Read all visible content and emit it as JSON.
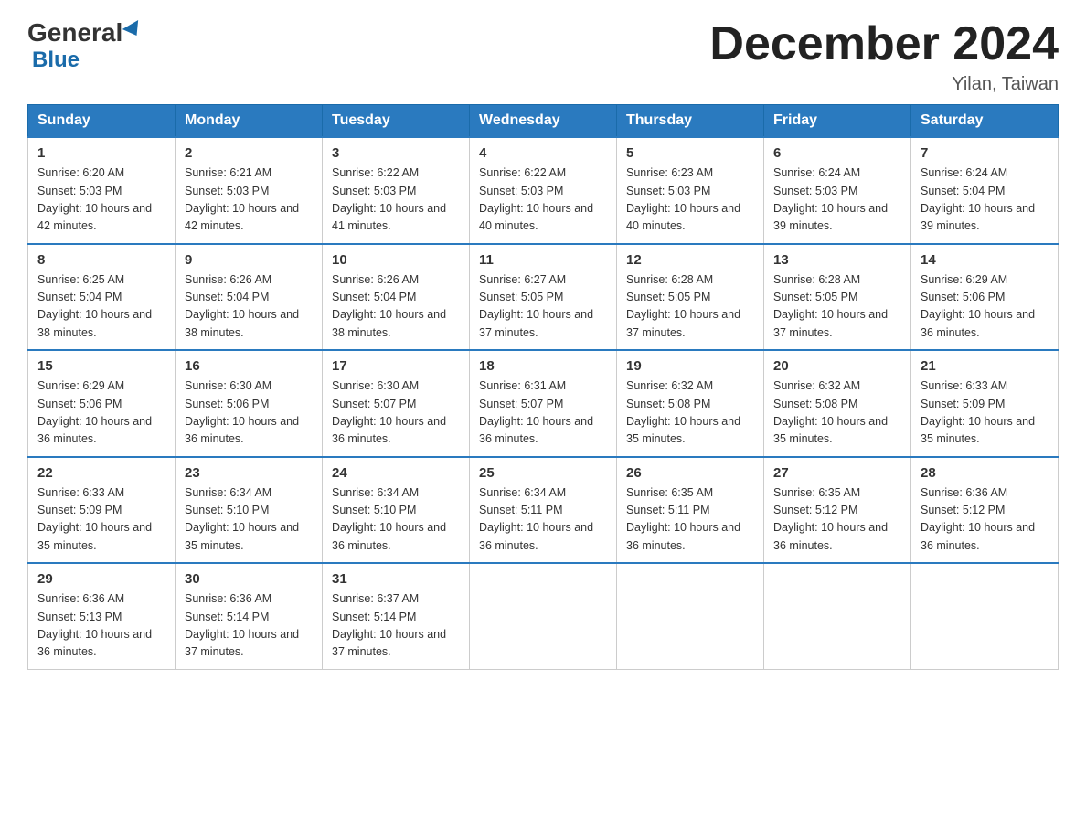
{
  "logo": {
    "general": "General",
    "blue": "Blue"
  },
  "title": "December 2024",
  "location": "Yilan, Taiwan",
  "days_of_week": [
    "Sunday",
    "Monday",
    "Tuesday",
    "Wednesday",
    "Thursday",
    "Friday",
    "Saturday"
  ],
  "weeks": [
    [
      {
        "day": "1",
        "sunrise": "6:20 AM",
        "sunset": "5:03 PM",
        "daylight": "10 hours and 42 minutes."
      },
      {
        "day": "2",
        "sunrise": "6:21 AM",
        "sunset": "5:03 PM",
        "daylight": "10 hours and 42 minutes."
      },
      {
        "day": "3",
        "sunrise": "6:22 AM",
        "sunset": "5:03 PM",
        "daylight": "10 hours and 41 minutes."
      },
      {
        "day": "4",
        "sunrise": "6:22 AM",
        "sunset": "5:03 PM",
        "daylight": "10 hours and 40 minutes."
      },
      {
        "day": "5",
        "sunrise": "6:23 AM",
        "sunset": "5:03 PM",
        "daylight": "10 hours and 40 minutes."
      },
      {
        "day": "6",
        "sunrise": "6:24 AM",
        "sunset": "5:03 PM",
        "daylight": "10 hours and 39 minutes."
      },
      {
        "day": "7",
        "sunrise": "6:24 AM",
        "sunset": "5:04 PM",
        "daylight": "10 hours and 39 minutes."
      }
    ],
    [
      {
        "day": "8",
        "sunrise": "6:25 AM",
        "sunset": "5:04 PM",
        "daylight": "10 hours and 38 minutes."
      },
      {
        "day": "9",
        "sunrise": "6:26 AM",
        "sunset": "5:04 PM",
        "daylight": "10 hours and 38 minutes."
      },
      {
        "day": "10",
        "sunrise": "6:26 AM",
        "sunset": "5:04 PM",
        "daylight": "10 hours and 38 minutes."
      },
      {
        "day": "11",
        "sunrise": "6:27 AM",
        "sunset": "5:05 PM",
        "daylight": "10 hours and 37 minutes."
      },
      {
        "day": "12",
        "sunrise": "6:28 AM",
        "sunset": "5:05 PM",
        "daylight": "10 hours and 37 minutes."
      },
      {
        "day": "13",
        "sunrise": "6:28 AM",
        "sunset": "5:05 PM",
        "daylight": "10 hours and 37 minutes."
      },
      {
        "day": "14",
        "sunrise": "6:29 AM",
        "sunset": "5:06 PM",
        "daylight": "10 hours and 36 minutes."
      }
    ],
    [
      {
        "day": "15",
        "sunrise": "6:29 AM",
        "sunset": "5:06 PM",
        "daylight": "10 hours and 36 minutes."
      },
      {
        "day": "16",
        "sunrise": "6:30 AM",
        "sunset": "5:06 PM",
        "daylight": "10 hours and 36 minutes."
      },
      {
        "day": "17",
        "sunrise": "6:30 AM",
        "sunset": "5:07 PM",
        "daylight": "10 hours and 36 minutes."
      },
      {
        "day": "18",
        "sunrise": "6:31 AM",
        "sunset": "5:07 PM",
        "daylight": "10 hours and 36 minutes."
      },
      {
        "day": "19",
        "sunrise": "6:32 AM",
        "sunset": "5:08 PM",
        "daylight": "10 hours and 35 minutes."
      },
      {
        "day": "20",
        "sunrise": "6:32 AM",
        "sunset": "5:08 PM",
        "daylight": "10 hours and 35 minutes."
      },
      {
        "day": "21",
        "sunrise": "6:33 AM",
        "sunset": "5:09 PM",
        "daylight": "10 hours and 35 minutes."
      }
    ],
    [
      {
        "day": "22",
        "sunrise": "6:33 AM",
        "sunset": "5:09 PM",
        "daylight": "10 hours and 35 minutes."
      },
      {
        "day": "23",
        "sunrise": "6:34 AM",
        "sunset": "5:10 PM",
        "daylight": "10 hours and 35 minutes."
      },
      {
        "day": "24",
        "sunrise": "6:34 AM",
        "sunset": "5:10 PM",
        "daylight": "10 hours and 36 minutes."
      },
      {
        "day": "25",
        "sunrise": "6:34 AM",
        "sunset": "5:11 PM",
        "daylight": "10 hours and 36 minutes."
      },
      {
        "day": "26",
        "sunrise": "6:35 AM",
        "sunset": "5:11 PM",
        "daylight": "10 hours and 36 minutes."
      },
      {
        "day": "27",
        "sunrise": "6:35 AM",
        "sunset": "5:12 PM",
        "daylight": "10 hours and 36 minutes."
      },
      {
        "day": "28",
        "sunrise": "6:36 AM",
        "sunset": "5:12 PM",
        "daylight": "10 hours and 36 minutes."
      }
    ],
    [
      {
        "day": "29",
        "sunrise": "6:36 AM",
        "sunset": "5:13 PM",
        "daylight": "10 hours and 36 minutes."
      },
      {
        "day": "30",
        "sunrise": "6:36 AM",
        "sunset": "5:14 PM",
        "daylight": "10 hours and 37 minutes."
      },
      {
        "day": "31",
        "sunrise": "6:37 AM",
        "sunset": "5:14 PM",
        "daylight": "10 hours and 37 minutes."
      },
      null,
      null,
      null,
      null
    ]
  ],
  "labels": {
    "sunrise": "Sunrise:",
    "sunset": "Sunset:",
    "daylight": "Daylight:"
  }
}
